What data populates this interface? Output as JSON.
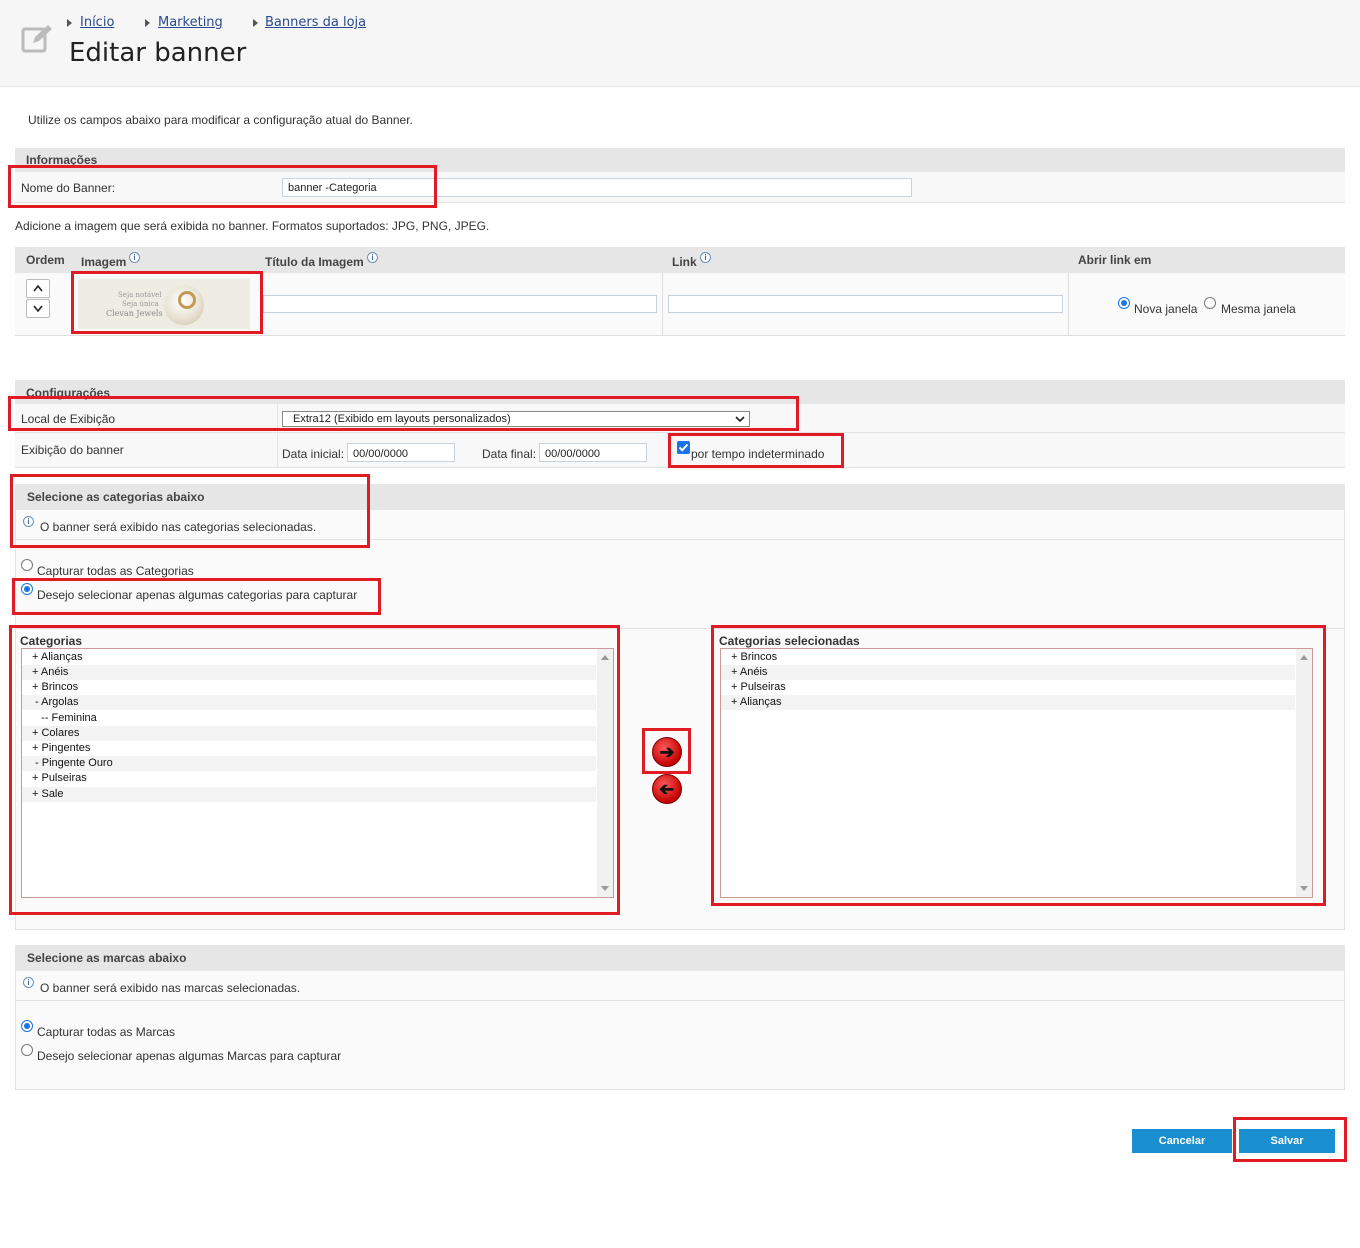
{
  "breadcrumb": [
    "Início",
    "Marketing",
    "Banners da loja"
  ],
  "page_title": "Editar banner",
  "intro": "Utilize os campos abaixo para modificar a configuração atual do Banner.",
  "info_section": {
    "title": "Informações",
    "name_label": "Nome do Banner:",
    "name_value": "banner -Categoria"
  },
  "image_note": "Adicione a imagem que será exibida no banner. Formatos suportados: JPG, PNG, JPEG.",
  "image_table": {
    "headers": {
      "order": "Ordem",
      "image": "Imagem",
      "title": "Título da Imagem",
      "link": "Link",
      "open": "Abrir link em"
    },
    "thumb_text": [
      "Seja notável",
      "Seja única",
      "Clevan Jewels"
    ],
    "open_options": {
      "new": "Nova janela",
      "same": "Mesma janela"
    },
    "open_selected": "Nova janela"
  },
  "config": {
    "title": "Configurações",
    "location_label": "Local de Exibição",
    "location_value": "Extra12 (Exibido em layouts personalizados)",
    "display_label": "Exibição do banner",
    "start_label": "Data inicial:",
    "start_value": "00/00/0000",
    "end_label": "Data final:",
    "end_value": "00/00/0000",
    "indefinite_label": "por tempo indeterminado",
    "indefinite_checked": true
  },
  "categories": {
    "title": "Selecione as categorias abaixo",
    "info": "O banner será exibido nas categorias selecionadas.",
    "opt_all": "Capturar todas as Categorias",
    "opt_some": "Desejo selecionar apenas algumas categorias para capturar",
    "selected_option": "some",
    "list_title": "Categorias",
    "list": [
      "+ Alianças",
      "+ Anéis",
      "+ Brincos",
      " - Argolas",
      "   -- Feminina",
      "+ Colares",
      "+ Pingentes",
      " - Pingente Ouro",
      "+ Pulseiras",
      "+ Sale"
    ],
    "selected_title": "Categorias selecionadas",
    "selected": [
      "+ Brincos",
      "+ Anéis",
      "+ Pulseiras",
      "+ Alianças"
    ]
  },
  "brands": {
    "title": "Selecione as marcas abaixo",
    "info": "O banner será exibido nas marcas selecionadas.",
    "opt_all": "Capturar todas as Marcas",
    "opt_some": "Desejo selecionar apenas algumas Marcas para capturar",
    "selected_option": "all"
  },
  "buttons": {
    "cancel": "Cancelar",
    "save": "Salvar"
  },
  "colors": {
    "highlight": "#e01b24",
    "button": "#1a8fd0",
    "link": "#2a4a8f"
  }
}
